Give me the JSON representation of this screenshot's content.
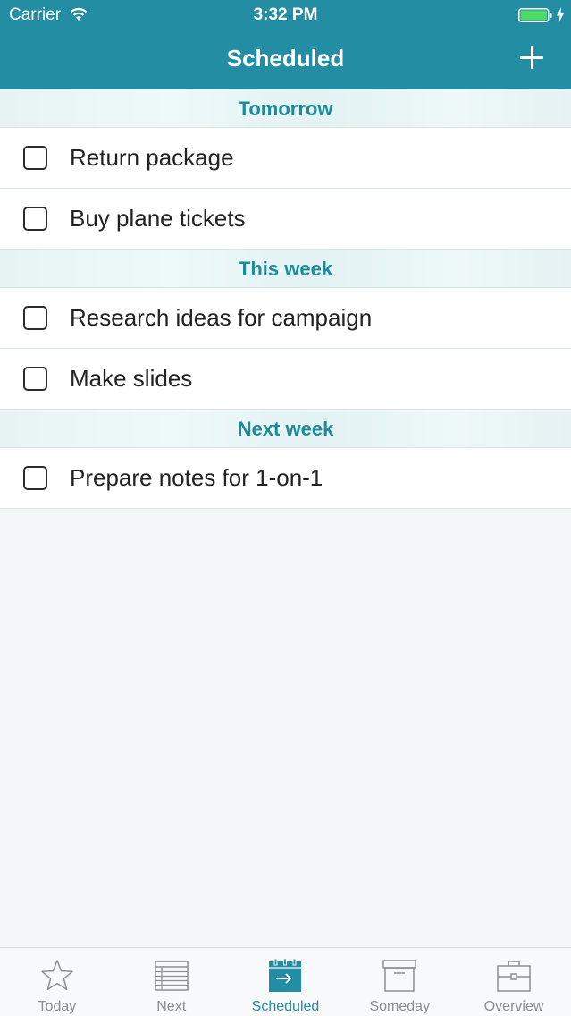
{
  "status_bar": {
    "carrier": "Carrier",
    "time": "3:32 PM"
  },
  "nav": {
    "title": "Scheduled"
  },
  "sections": [
    {
      "title": "Tomorrow",
      "items": [
        "Return package",
        "Buy plane tickets"
      ]
    },
    {
      "title": "This week",
      "items": [
        "Research ideas for campaign",
        "Make slides"
      ]
    },
    {
      "title": "Next week",
      "items": [
        "Prepare notes for 1-on-1"
      ]
    }
  ],
  "tabs": [
    {
      "label": "Today",
      "icon": "star-icon",
      "active": false
    },
    {
      "label": "Next",
      "icon": "list-icon",
      "active": false
    },
    {
      "label": "Scheduled",
      "icon": "calendar-icon",
      "active": true
    },
    {
      "label": "Someday",
      "icon": "archive-box-icon",
      "active": false
    },
    {
      "label": "Overview",
      "icon": "briefcase-icon",
      "active": false
    }
  ],
  "colors": {
    "accent": "#238da3",
    "section_text": "#1b8b9c",
    "battery": "#4cd964"
  }
}
